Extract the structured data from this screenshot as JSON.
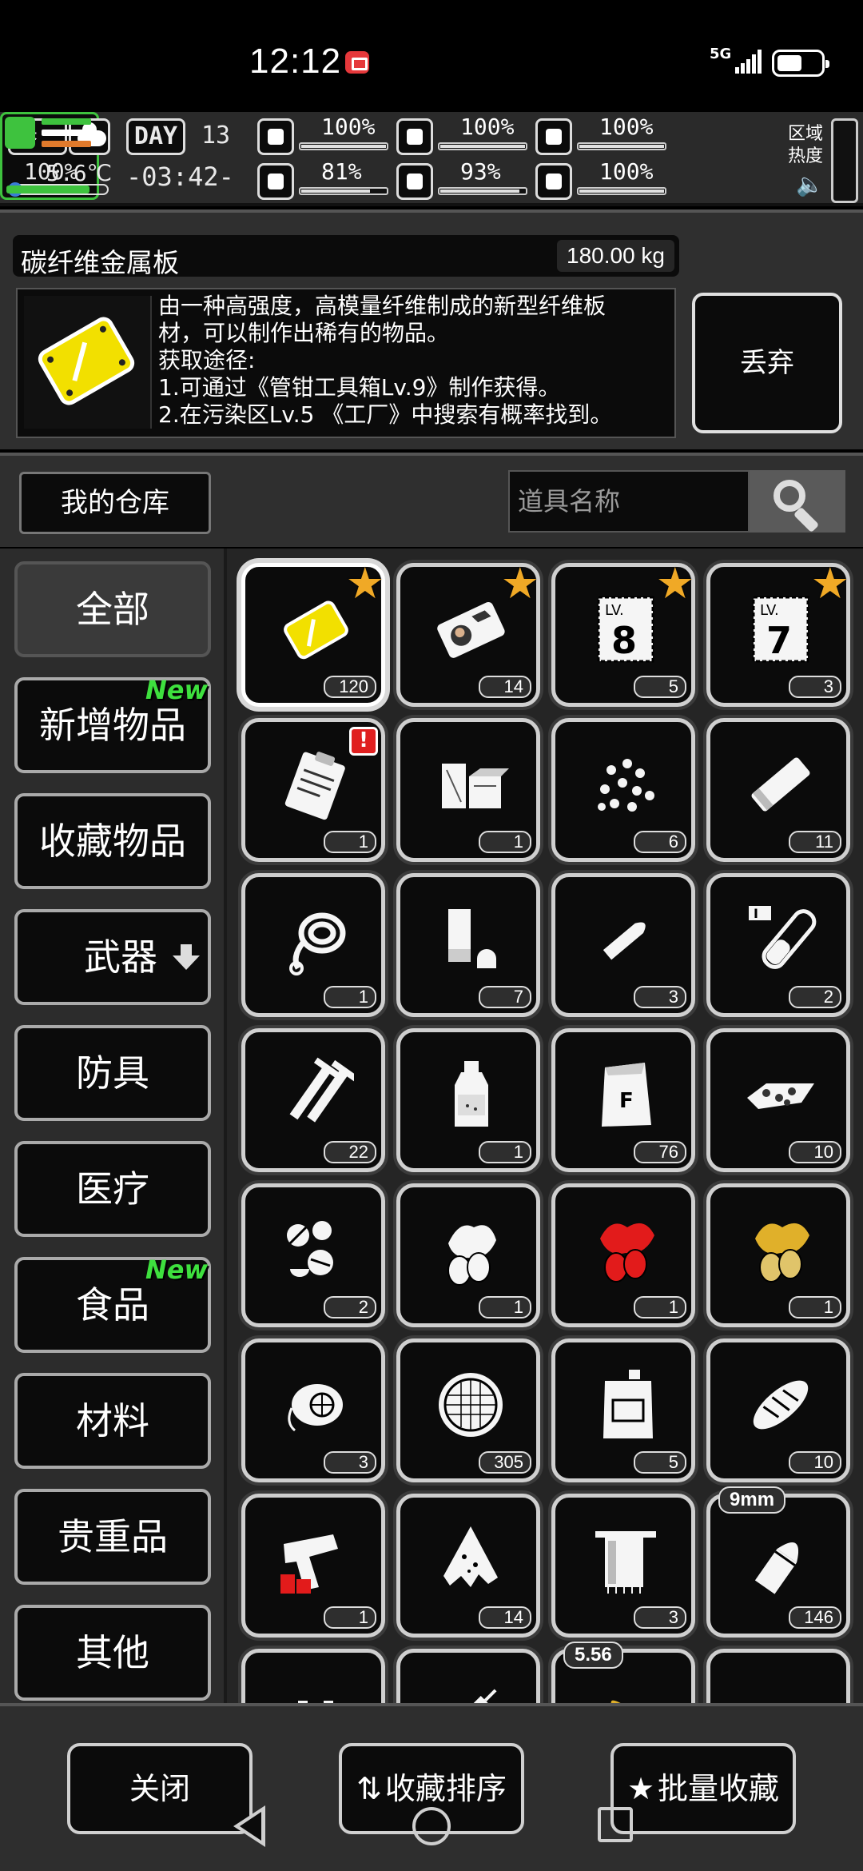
{
  "status_bar": {
    "time": "12:12",
    "network": "5G"
  },
  "hud": {
    "season": "春",
    "temperature": "5.6℃",
    "day_label": "DAY",
    "day_number": "13",
    "clock": "-03:42-",
    "stats": [
      {
        "icon": "medkit-icon",
        "value": "100%",
        "level": 1.0
      },
      {
        "icon": "stomach-icon",
        "value": "100%",
        "level": 1.0
      },
      {
        "icon": "battery-status-icon",
        "value": "100%",
        "level": 1.0
      },
      {
        "icon": "brain-icon",
        "value": "81%",
        "level": 0.81
      },
      {
        "icon": "water-drop-icon",
        "value": "93%",
        "level": 0.93
      },
      {
        "icon": "heart-icon",
        "value": "100%",
        "level": 1.0
      }
    ],
    "stamina": "100%",
    "heat_label_1": "区域",
    "heat_label_2": "热度",
    "colors": {
      "stamina": "#3ec23e",
      "flag_orange": "#e07a2c"
    }
  },
  "detail": {
    "name": "碳纤维金属板",
    "weight": "180.00 kg",
    "description": [
      "由一种高强度，高模量纤维制成的新型纤维板",
      "材，可以制作出稀有的物品。",
      "获取途径:",
      "1.可通过《管钳工具箱Lv.9》制作获得。",
      "2.在污染区Lv.5 《工厂》中搜索有概率找到。"
    ],
    "discard_label": "丢弃"
  },
  "warehouse": {
    "tab_label": "我的仓库",
    "search_placeholder": "道具名称"
  },
  "categories": [
    {
      "label": "全部",
      "active": true
    },
    {
      "label": "新增物品",
      "new": "New"
    },
    {
      "label": "收藏物品"
    },
    {
      "label": "武器",
      "arrow": true
    },
    {
      "label": "防具"
    },
    {
      "label": "医疗"
    },
    {
      "label": "食品",
      "new": "New"
    },
    {
      "label": "材料"
    },
    {
      "label": "贵重品"
    },
    {
      "label": "其他"
    }
  ],
  "items": [
    {
      "icon": "carbon-plate-icon",
      "count": "120",
      "favorite": true,
      "selected": true
    },
    {
      "icon": "id-card-icon",
      "count": "14",
      "favorite": true
    },
    {
      "icon": "blueprint-lv8-icon",
      "count": "5",
      "favorite": true,
      "level": "8"
    },
    {
      "icon": "blueprint-lv7-icon",
      "count": "3",
      "favorite": true,
      "level": "7"
    },
    {
      "icon": "clipboard-icon",
      "count": "1",
      "alert": "!"
    },
    {
      "icon": "wood-blocks-icon",
      "count": "1"
    },
    {
      "icon": "seeds-icon",
      "count": "6"
    },
    {
      "icon": "metal-bar-icon",
      "count": "11"
    },
    {
      "icon": "rope-icon",
      "count": "1"
    },
    {
      "icon": "tape-icon",
      "count": "7"
    },
    {
      "icon": "blade-icon",
      "count": "3"
    },
    {
      "icon": "test-tube-icon",
      "count": "2"
    },
    {
      "icon": "nails-icon",
      "count": "22"
    },
    {
      "icon": "bottle-icon",
      "count": "1"
    },
    {
      "icon": "flour-sack-icon",
      "count": "76"
    },
    {
      "icon": "scrap-pile-icon",
      "count": "10"
    },
    {
      "icon": "pills-icon",
      "count": "2"
    },
    {
      "icon": "herb-icon",
      "count": "1"
    },
    {
      "icon": "red-herb-icon",
      "count": "1"
    },
    {
      "icon": "yellow-herb-icon",
      "count": "1"
    },
    {
      "icon": "gas-mask-icon",
      "count": "3"
    },
    {
      "icon": "filter-mesh-icon",
      "count": "305"
    },
    {
      "icon": "jerry-can-icon",
      "count": "5"
    },
    {
      "icon": "bread-icon",
      "count": "10"
    },
    {
      "icon": "flare-gun-icon",
      "count": "1"
    },
    {
      "icon": "cloth-scrap-icon",
      "count": "14"
    },
    {
      "icon": "towel-icon",
      "count": "3"
    },
    {
      "icon": "bullet-9mm-icon",
      "count": "146",
      "caliber": "9mm"
    },
    {
      "icon": "battery-pack-icon",
      "count": ""
    },
    {
      "icon": "syringe-icon",
      "count": ""
    },
    {
      "icon": "bullet-556-icon",
      "count": "",
      "caliber": "5.56"
    },
    {
      "icon": "ingot-icon",
      "count": ""
    }
  ],
  "bottom": {
    "close_label": "关闭",
    "sort_label": "收藏排序",
    "batch_label": "批量收藏"
  }
}
